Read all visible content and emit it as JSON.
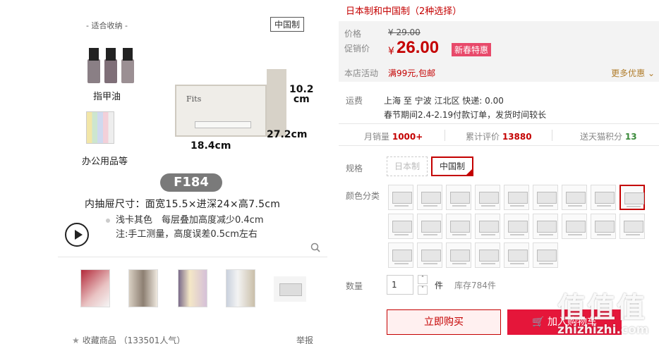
{
  "gallery": {
    "suit_label": "- 适合收纳 -",
    "origin_badge": "中国制",
    "item1": "指甲油",
    "item2": "办公用品等",
    "brand": "Fits",
    "dim_height": "10.2\ncm",
    "dim_depth": "27.2cm",
    "dim_width": "18.4cm",
    "model": "F184",
    "size_text": "内抽屉尺寸：面宽15.5×进深24×高7.5cm",
    "note1": "浅卡其色　每层叠加高度减少0.4cm",
    "note2": "注:手工测量，高度误差0.5cm左右",
    "favorite": "收藏商品 （133501人气）",
    "report": "举报"
  },
  "details": {
    "subtitle": "日本制和中国制（2种选择）",
    "price_label": "价格",
    "orig_price": "¥ 29.00",
    "promo_label": "促销价",
    "yen": "¥",
    "promo_price": "26.00",
    "promo_tag": "新春特惠",
    "shop_label": "本店活动",
    "shop_value": "满99元,包邮",
    "more_label": "更多优惠",
    "ship_label": "运费",
    "ship_line1": "上海 至 宁波 江北区 快递: 0.00",
    "ship_line2": "春节期间2.4-2.19付款订单，发货时间较长",
    "stats": {
      "monthly_label": "月销量",
      "monthly_value": "1000+",
      "review_label": "累计评价",
      "review_value": "13880",
      "points_label": "送天猫积分",
      "points_value": "13"
    },
    "spec_label": "规格",
    "spec_options": [
      "日本制",
      "中国制"
    ],
    "color_label": "颜色分类",
    "qty_label": "数量",
    "qty_value": "1",
    "unit": "件",
    "stock": "库存784件",
    "buy_label": "立即购买",
    "cart_label": "加入购物车"
  },
  "watermark": {
    "big": "值值值",
    "small": "zhizhizhi.com"
  },
  "colors": {
    "accent": "#c40000",
    "cart": "#e5163a",
    "tag": "#e8496a"
  }
}
